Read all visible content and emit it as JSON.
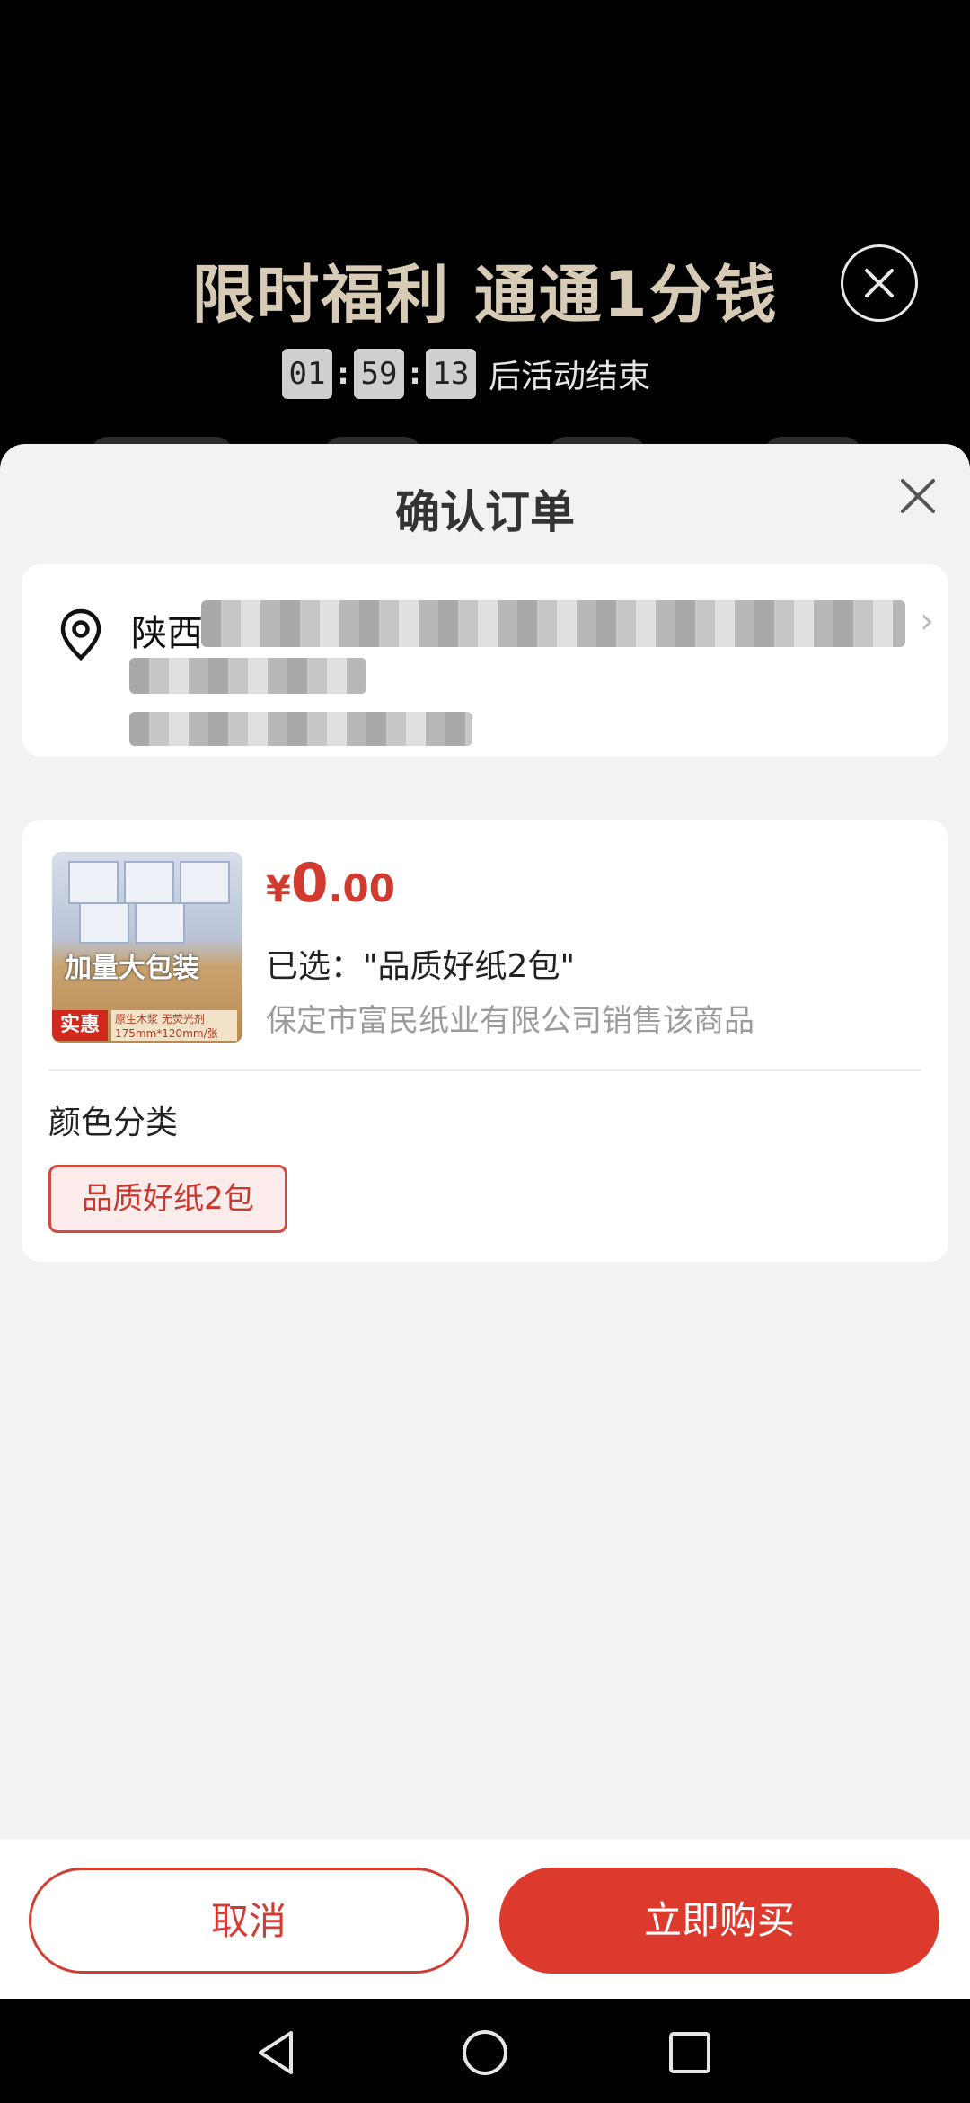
{
  "promo": {
    "title": "限时福利 通通1分钱",
    "countdown": {
      "hours": "01",
      "minutes": "59",
      "seconds": "13",
      "separator": ":",
      "suffix": "后活动结束"
    }
  },
  "sheet": {
    "title": "确认订单",
    "address": {
      "line1_visible": "陕西"
    },
    "product": {
      "price": {
        "currency": "¥",
        "integer": "0",
        "decimal": ".00"
      },
      "selected_text": "已选：\"品质好纸2包\"",
      "seller_text": "保定市富民纸业有限公司销售该商品",
      "image": {
        "main_text": "加量大包装",
        "badge": "实惠",
        "desc": "原生木浆 无荧光剂 175mm*120mm/张"
      }
    },
    "category": {
      "label": "颜色分类",
      "options": [
        "品质好纸2包"
      ],
      "selected_index": 0
    }
  },
  "actions": {
    "cancel_label": "取消",
    "buy_label": "立即购买"
  },
  "colors": {
    "accent": "#dd3a2e",
    "promo_title": "#d7cbb6",
    "sheet_bg": "#f2f2f2"
  },
  "icons": [
    "close-icon",
    "location-pin-icon",
    "chevron-right-icon",
    "back-triangle-icon",
    "home-circle-icon",
    "recents-square-icon"
  ]
}
